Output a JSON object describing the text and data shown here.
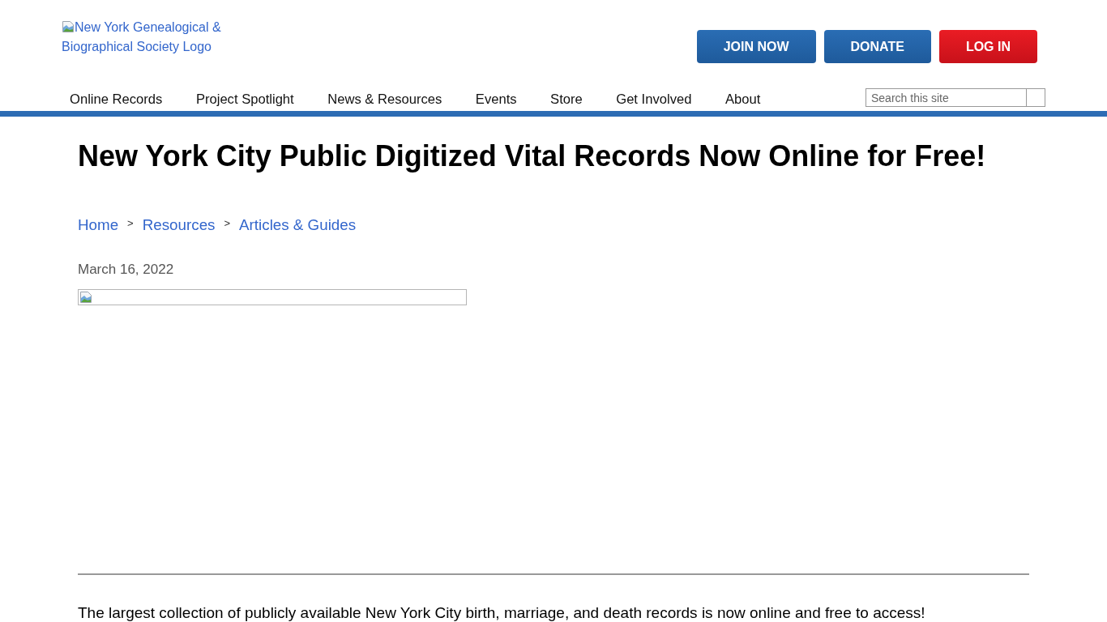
{
  "header": {
    "logo": {
      "alt_text": "New York Genealogical & Biographical Society Logo"
    },
    "buttons": [
      {
        "label": "JOIN NOW",
        "kind": "primary"
      },
      {
        "label": "DONATE",
        "kind": "primary"
      },
      {
        "label": "LOG IN",
        "kind": "danger"
      }
    ]
  },
  "nav": {
    "items": [
      "Online Records",
      "Project Spotlight",
      "News & Resources",
      "Events",
      "Store",
      "Get Involved",
      "About"
    ],
    "search": {
      "placeholder": "Search this site"
    }
  },
  "article": {
    "title": "New York City Public Digitized Vital Records Now Online for Free!",
    "breadcrumb": {
      "items": [
        "Home",
        "Resources",
        "Articles & Guides"
      ],
      "separators": [
        ">",
        ">"
      ]
    },
    "date": "March 16, 2022",
    "intro": "The largest collection of publicly available New York City birth, marriage, and death records is now online and free to access!"
  }
}
